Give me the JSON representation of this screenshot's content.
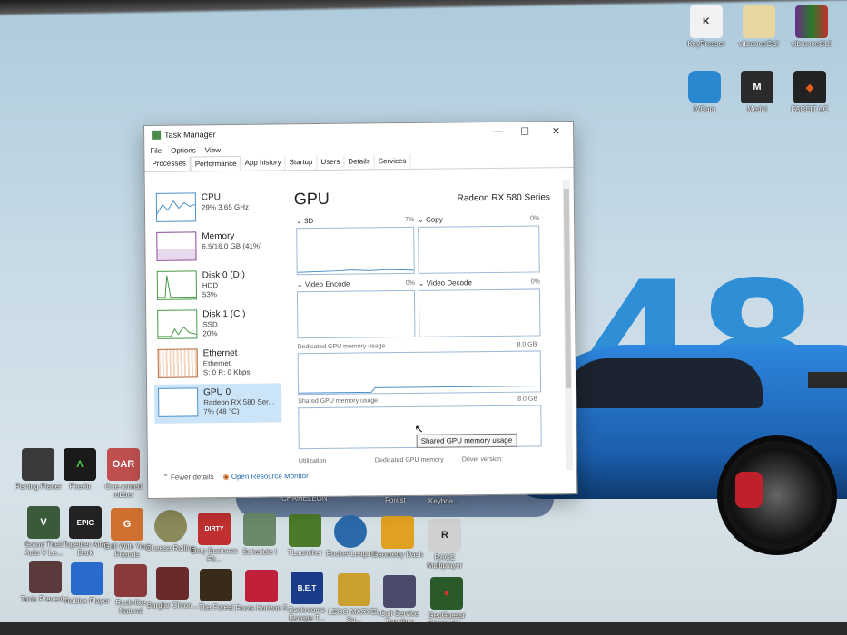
{
  "desktop": {
    "top_icons": [
      {
        "label": "KeyPresser",
        "glyph": "K",
        "color": "#f2f2f2"
      },
      {
        "label": "vibranceGUI",
        "glyph": "",
        "color": "#e8d6a0"
      },
      {
        "label": "vibranceGUI",
        "glyph": "",
        "color": "#6a2c8a"
      },
      {
        "label": "IVCam",
        "glyph": "",
        "color": "#2a88d0"
      },
      {
        "label": "Medal",
        "glyph": "M",
        "color": "#2b2b2b"
      },
      {
        "label": "FACEIT AC",
        "glyph": "",
        "color": "#222"
      }
    ],
    "left_icons_row1": [
      {
        "label": "Fishing Planet",
        "glyph": "",
        "color": "#3a3a3a"
      },
      {
        "label": "FireAlt",
        "glyph": "",
        "color": "#1a1a1a"
      },
      {
        "label": "One-armed robber",
        "glyph": "OAR",
        "color": "#c05050"
      }
    ],
    "row2": [
      {
        "label": "Grand Theft Auto V Le...",
        "glyph": "V",
        "color": "#3a5a3a"
      },
      {
        "label": "Together After Dark",
        "glyph": "EPIC",
        "color": "#222"
      },
      {
        "label": "Grill With Your Friends",
        "glyph": "G",
        "color": "#d07030"
      },
      {
        "label": "Cheese Rolling",
        "glyph": "",
        "color": "#8a8a5a"
      },
      {
        "label": "Dirty Business Ffr...",
        "glyph": "DIRTY",
        "color": "#c03030"
      },
      {
        "label": "Schedule I",
        "glyph": "",
        "color": "#6a8a6a"
      },
      {
        "label": "TLauncher",
        "glyph": "",
        "color": "#4a7a2a"
      },
      {
        "label": "Rocket League",
        "glyph": "",
        "color": "#2a6aaa"
      },
      {
        "label": "Geometry Dash",
        "glyph": "",
        "color": "#e0a020"
      },
      {
        "label": "RAGE Multiplayer",
        "glyph": "R",
        "color": "#d0d0d0"
      }
    ],
    "row3": [
      {
        "label": "Toxic Prevent...",
        "glyph": "",
        "color": "#5a3a3a"
      },
      {
        "label": "Roblox Player",
        "glyph": "",
        "color": "#2a6aca"
      },
      {
        "label": "Rock-like Natural",
        "glyph": "",
        "color": "#8a3a3a"
      },
      {
        "label": "Burglar Chron...",
        "glyph": "",
        "color": "#6a2a2a"
      },
      {
        "label": "The Forest",
        "glyph": "",
        "color": "#3a2a1a"
      },
      {
        "label": "Forza Horizon 5",
        "glyph": "",
        "color": "#c0203a"
      },
      {
        "label": "Backrooms Escape T...",
        "glyph": "B.E.T",
        "color": "#1a3a8a"
      },
      {
        "label": "LEGO MARVEL Su...",
        "glyph": "",
        "color": "#caa030"
      },
      {
        "label": "Call Service Together",
        "glyph": "",
        "color": "#4a4a6a"
      },
      {
        "label": "GeoGuessr Steam Ed...",
        "glyph": "",
        "color": "#2a5a2a"
      }
    ],
    "mid_labels": [
      "Mechanic",
      "CHAMELEON",
      "Forest",
      "Keyboa..."
    ],
    "wallpaper_number": "48"
  },
  "taskmanager": {
    "title": "Task Manager",
    "menu": [
      "File",
      "Options",
      "View"
    ],
    "tabs": [
      "Processes",
      "Performance",
      "App history",
      "Startup",
      "Users",
      "Details",
      "Services"
    ],
    "active_tab": "Performance",
    "sidebar": [
      {
        "name": "CPU",
        "sub1": "29% 3.65 GHz",
        "sub2": "",
        "sub3": ""
      },
      {
        "name": "Memory",
        "sub1": "6.5/16.0 GB (41%)",
        "sub2": "",
        "sub3": ""
      },
      {
        "name": "Disk 0 (D:)",
        "sub1": "HDD",
        "sub2": "53%",
        "sub3": ""
      },
      {
        "name": "Disk 1 (C:)",
        "sub1": "SSD",
        "sub2": "20%",
        "sub3": ""
      },
      {
        "name": "Ethernet",
        "sub1": "Ethernet",
        "sub2": "S: 0 R: 0 Kbps",
        "sub3": ""
      },
      {
        "name": "GPU 0",
        "sub1": "Radeon RX 580 Ser...",
        "sub2": "7% (48 °C)",
        "sub3": ""
      }
    ],
    "gpu": {
      "title": "GPU",
      "model": "Radeon RX 580 Series",
      "engines": [
        {
          "label": "3D",
          "pct": "7%"
        },
        {
          "label": "Copy",
          "pct": "0%"
        },
        {
          "label": "Video Encode",
          "pct": "0%"
        },
        {
          "label": "Video Decode",
          "pct": "0%"
        }
      ],
      "dedicated_label": "Dedicated GPU memory usage",
      "dedicated_max": "8.0 GB",
      "shared_label": "Shared GPU memory usage",
      "shared_max": "8.0 GB",
      "tooltip": "Shared GPU memory usage",
      "bottom": [
        "Utilization",
        "Dedicated GPU memory",
        "Driver version:"
      ]
    },
    "footer": {
      "fewer": "Fewer details",
      "monitor": "Open Resource Monitor"
    }
  }
}
